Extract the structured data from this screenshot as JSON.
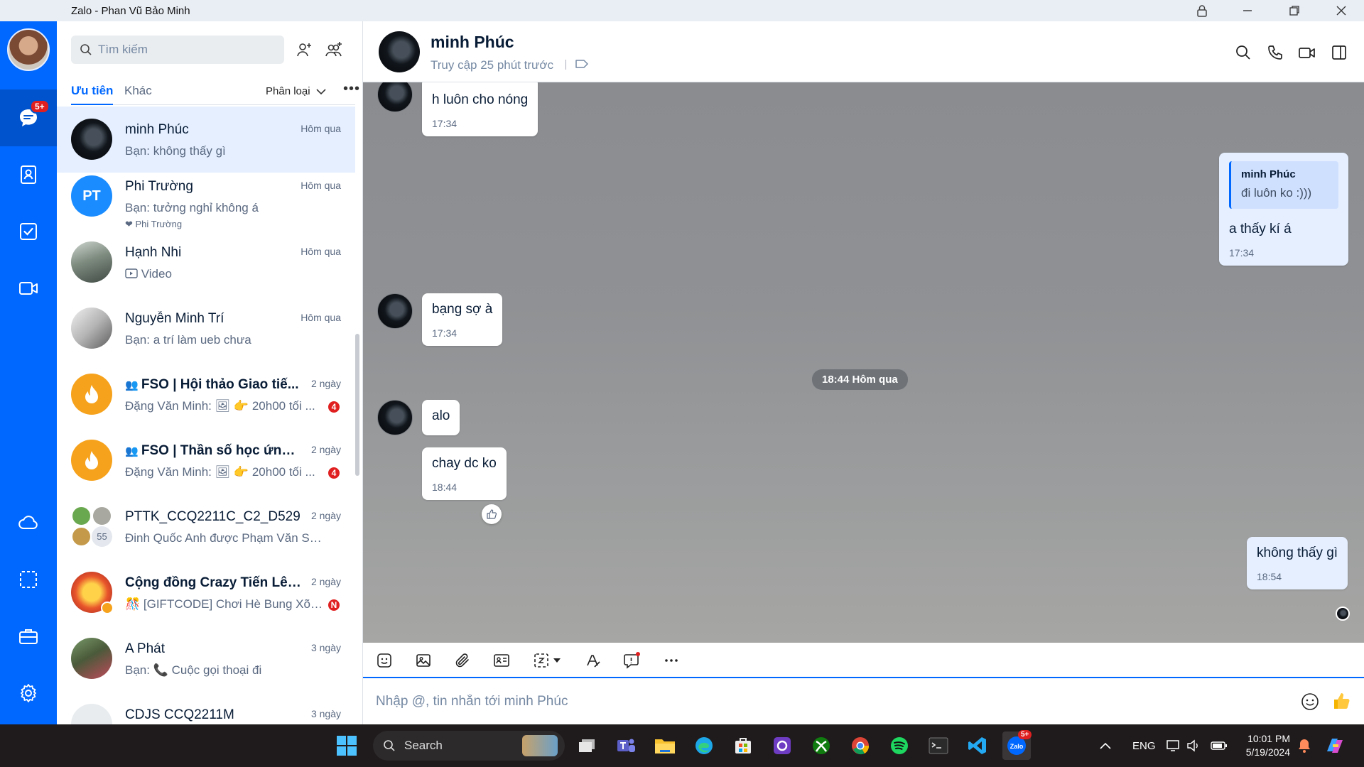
{
  "window": {
    "title": "Zalo - Phan Vũ Bảo Minh"
  },
  "rail": {
    "messages_badge": "5+",
    "items": [
      "messages-icon",
      "contacts-icon",
      "todo-icon",
      "video-icon",
      "cloud-icon",
      "capture-icon",
      "toolbox-icon",
      "settings-icon"
    ]
  },
  "search": {
    "placeholder": "Tìm kiếm"
  },
  "tabs": {
    "priority": "Ưu tiên",
    "other": "Khác",
    "classify": "Phân loại"
  },
  "conversations": [
    {
      "name": "minh Phúc",
      "time": "Hôm qua",
      "preview": "Bạn: không thấy gì"
    },
    {
      "name": "Phi Trường",
      "time": "Hôm qua",
      "preview": "Bạn: tưởng nghỉ không á",
      "initials": "PT",
      "reaction": "❤ Phi Trường"
    },
    {
      "name": "Hạnh Nhi",
      "time": "Hôm qua",
      "preview": "Video"
    },
    {
      "name": "Nguyễn Minh Trí",
      "time": "Hôm qua",
      "preview": "Bạn: a trí làm ueb chưa"
    },
    {
      "name": "FSO | Hội thảo Giao tiế...",
      "time": "2 ngày",
      "preview": "Đặng Văn Minh: 🖼 👉 20h00 tối ...",
      "unread": "4"
    },
    {
      "name": "FSO | Thần số học ứng ...",
      "time": "2 ngày",
      "preview": "Đặng Văn Minh: 🖼 👉 20h00 tối ...",
      "unread": "4"
    },
    {
      "name": "PTTK_CCQ2211C_C2_D529",
      "time": "2 ngày",
      "preview": "Đinh Quốc Anh được Phạm Văn Sơn t...",
      "member_count": "55"
    },
    {
      "name": "Cộng đồng Crazy Tiến Lên...",
      "time": "2 ngày",
      "preview": "🎊 [GIFTCODE] Chơi Hè Bung Xõa...",
      "unread": "N"
    },
    {
      "name": "A Phát",
      "time": "3 ngày",
      "preview": "Bạn: 📞 Cuộc gọi thoại đi"
    },
    {
      "name": "CDJS CCQ2211M",
      "time": "3 ngày",
      "preview": ""
    }
  ],
  "chat": {
    "name": "minh Phúc",
    "status": "Truy cập 25 phút trước",
    "messages": [
      {
        "text": "h luôn cho nóng",
        "time": "17:34"
      },
      {
        "quote_name": "minh Phúc",
        "quote_text": "đi luôn ko :)))",
        "text": "a thấy kí á",
        "time": "17:34"
      },
      {
        "text": "bạng sợ à",
        "time": "17:34"
      },
      {
        "text": "alo"
      },
      {
        "text": "chay dc ko",
        "time": "18:44"
      },
      {
        "text": "không thấy gì",
        "time": "18:54"
      }
    ],
    "date_separator": "18:44 Hôm qua"
  },
  "composer": {
    "placeholder": "Nhập @, tin nhắn tới minh Phúc"
  },
  "taskbar": {
    "search": "Search",
    "lang": "ENG",
    "time": "10:01 PM",
    "date": "5/19/2024",
    "zalo_badge": "5+"
  },
  "colors": {
    "accent": "#0068ff",
    "rail": "#0068ff",
    "unread": "#e02020"
  }
}
